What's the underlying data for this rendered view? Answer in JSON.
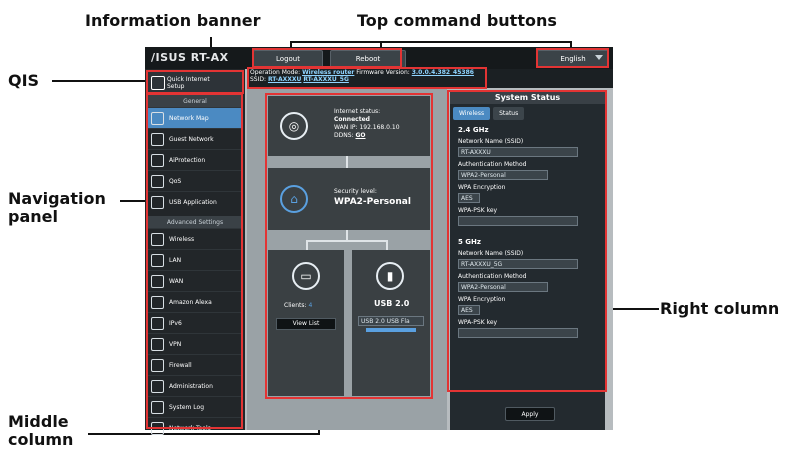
{
  "annotations": {
    "information_banner": "Information banner",
    "top_command_buttons": "Top command buttons",
    "qis": "QIS",
    "navigation_panel": [
      "Navigation",
      "panel"
    ],
    "right_column": "Right column",
    "middle_column": [
      "Middle",
      "column"
    ]
  },
  "router": {
    "logo": "/ISUS  RT-AX",
    "top_buttons": {
      "logout": "Logout",
      "reboot": "Reboot",
      "language": "English"
    },
    "banner": {
      "op_mode_label": "Operation Mode:",
      "op_mode_value": "Wireless router",
      "fw_label": "Firmware Version:",
      "fw_value": "3.0.0.4.382_45386",
      "ssid_label": "SSID:",
      "ssid_2g": "RT-AXXXU",
      "ssid_5g": "RT-AXXXU_5G"
    },
    "qis": {
      "label_1": "Quick Internet",
      "label_2": "Setup"
    },
    "nav": {
      "general_header": "General",
      "general_items": [
        {
          "label": "Network Map",
          "icon": "network-map-icon"
        },
        {
          "label": "Guest Network",
          "icon": "guest-network-icon"
        },
        {
          "label": "AiProtection",
          "icon": "aiprotection-icon"
        },
        {
          "label": "QoS",
          "icon": "qos-icon"
        },
        {
          "label": "USB Application",
          "icon": "usb-application-icon"
        }
      ],
      "advanced_header": "Advanced Settings",
      "advanced_items": [
        {
          "label": "Wireless",
          "icon": "wireless-icon"
        },
        {
          "label": "LAN",
          "icon": "lan-icon"
        },
        {
          "label": "WAN",
          "icon": "wan-icon"
        },
        {
          "label": "Amazon Alexa",
          "icon": "amazon-alexa-icon"
        },
        {
          "label": "IPv6",
          "icon": "ipv6-icon"
        },
        {
          "label": "VPN",
          "icon": "vpn-icon"
        },
        {
          "label": "Firewall",
          "icon": "firewall-icon"
        },
        {
          "label": "Administration",
          "icon": "administration-icon"
        },
        {
          "label": "System Log",
          "icon": "system-log-icon"
        },
        {
          "label": "Network Tools",
          "icon": "network-tools-icon"
        }
      ]
    },
    "middle": {
      "internet_status_label": "Internet status:",
      "internet_status_value": "Connected",
      "wan_ip_label": "WAN IP:",
      "wan_ip_value": "192.168.0.10",
      "ddns_label": "DDNS:",
      "ddns_value": "GO",
      "security_label": "Security level:",
      "security_value": "WPA2-Personal",
      "clients_label": "Clients:",
      "clients_value": "4",
      "view_list": "View List",
      "usb_label": "USB 2.0",
      "usb_select": "USB 2.0 USB Fla"
    },
    "status": {
      "title": "System Status",
      "tab_wireless": "Wireless",
      "tab_status": "Status",
      "band_24": "2.4 GHz",
      "band_5": "5 GHz",
      "network_name_label": "Network Name (SSID)",
      "ssid_24": "RT-AXXXU",
      "ssid_5": "RT-AXXXU_5G",
      "auth_label": "Authentication Method",
      "auth_value": "WPA2-Personal",
      "enc_label": "WPA Encryption",
      "enc_value": "AES",
      "psk_label": "WPA-PSK key",
      "apply": "Apply"
    }
  }
}
